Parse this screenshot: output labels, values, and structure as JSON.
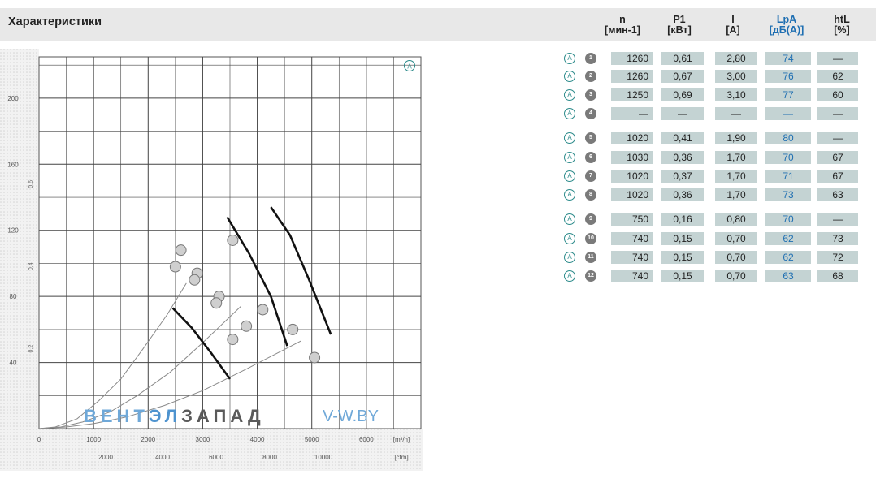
{
  "header": {
    "title": "Характеристики"
  },
  "table": {
    "columns": [
      {
        "label": "n",
        "unit": "[мин-1]",
        "color": "#222222"
      },
      {
        "label": "P1",
        "unit": "[кВт]",
        "color": "#222222"
      },
      {
        "label": "I",
        "unit": "[A]",
        "color": "#222222"
      },
      {
        "label": "LpA",
        "unit": "[дБ(A)]",
        "color": "#1f6fb2"
      },
      {
        "label": "htL",
        "unit": "[%]",
        "color": "#222222"
      }
    ],
    "rows": [
      {
        "mark": "A",
        "num": "1",
        "n": "1260",
        "p1": "0,61",
        "i": "2,80",
        "lpa": "74",
        "htl": "—"
      },
      {
        "mark": "A",
        "num": "2",
        "n": "1260",
        "p1": "0,67",
        "i": "3,00",
        "lpa": "76",
        "htl": "62"
      },
      {
        "mark": "A",
        "num": "3",
        "n": "1250",
        "p1": "0,69",
        "i": "3,10",
        "lpa": "77",
        "htl": "60"
      },
      {
        "mark": "A",
        "num": "4",
        "n": "—",
        "p1": "—",
        "i": "—",
        "lpa": "—",
        "htl": "—"
      },
      {
        "mark": "A",
        "num": "5",
        "n": "1020",
        "p1": "0,41",
        "i": "1,90",
        "lpa": "80",
        "htl": "—"
      },
      {
        "mark": "A",
        "num": "6",
        "n": "1030",
        "p1": "0,36",
        "i": "1,70",
        "lpa": "70",
        "htl": "67"
      },
      {
        "mark": "A",
        "num": "7",
        "n": "1020",
        "p1": "0,37",
        "i": "1,70",
        "lpa": "71",
        "htl": "67"
      },
      {
        "mark": "A",
        "num": "8",
        "n": "1020",
        "p1": "0,36",
        "i": "1,70",
        "lpa": "73",
        "htl": "63"
      },
      {
        "mark": "A",
        "num": "9",
        "n": "750",
        "p1": "0,16",
        "i": "0,80",
        "lpa": "70",
        "htl": "—"
      },
      {
        "mark": "A",
        "num": "10",
        "n": "740",
        "p1": "0,15",
        "i": "0,70",
        "lpa": "62",
        "htl": "73"
      },
      {
        "mark": "A",
        "num": "11",
        "n": "740",
        "p1": "0,15",
        "i": "0,70",
        "lpa": "62",
        "htl": "72"
      },
      {
        "mark": "A",
        "num": "12",
        "n": "740",
        "p1": "0,15",
        "i": "0,70",
        "lpa": "63",
        "htl": "68"
      }
    ]
  },
  "chart_data": {
    "type": "line",
    "title": "",
    "curve_label": "A",
    "xlabel_m3h": "[m³/h]",
    "xlabel_cfm": "[cfm]",
    "x_ticks_m3h": [
      "0",
      "1000",
      "2000",
      "3000",
      "4000",
      "5000",
      "6000",
      "[m³/h]"
    ],
    "x_ticks_cfm": [
      "2000",
      "4000",
      "6000",
      "8000",
      "10000",
      "[cfm]"
    ],
    "y_ticks_pa": [
      "40",
      "80",
      "120",
      "160",
      "200"
    ],
    "y_ticks_inwg": [
      "0,2",
      "0,4",
      "0,6"
    ],
    "xlim": [
      0,
      7000
    ],
    "ylim": [
      0,
      225
    ],
    "grid": true,
    "series": [
      {
        "x": [
          2450,
          2800,
          3150,
          3500
        ],
        "y": [
          73,
          61,
          46,
          30
        ]
      },
      {
        "x": [
          3450,
          3850,
          4250,
          4550
        ],
        "y": [
          128,
          106,
          80,
          50
        ]
      },
      {
        "x": [
          4250,
          4600,
          4950,
          5350
        ],
        "y": [
          134,
          117,
          90,
          57
        ]
      }
    ],
    "system_curves": [
      {
        "x": [
          0,
          300,
          700,
          1100,
          1500,
          1900,
          2350,
          2700
        ],
        "y": [
          0,
          1,
          6,
          17,
          30,
          48,
          69,
          88
        ]
      },
      {
        "x": [
          0,
          400,
          800,
          1300,
          1800,
          2400,
          3000,
          3700
        ],
        "y": [
          0,
          1,
          4,
          10,
          20,
          34,
          52,
          74
        ]
      },
      {
        "x": [
          0,
          500,
          1000,
          1600,
          2300,
          3000,
          3800,
          4800
        ],
        "y": [
          0,
          1,
          3,
          7,
          14,
          23,
          36,
          53
        ]
      }
    ],
    "points": [
      {
        "label": "1",
        "x": 3550,
        "y": 114
      },
      {
        "label": "2",
        "x": 4100,
        "y": 72
      },
      {
        "label": "3",
        "x": 4650,
        "y": 60
      },
      {
        "label": "4",
        "x": 5050,
        "y": 43
      },
      {
        "label": "5",
        "x": 2600,
        "y": 108
      },
      {
        "label": "6",
        "x": 2900,
        "y": 94
      },
      {
        "label": "7",
        "x": 3300,
        "y": 80
      },
      {
        "label": "8",
        "x": 3800,
        "y": 62
      },
      {
        "label": "9",
        "x": 2500,
        "y": 98
      },
      {
        "label": "10",
        "x": 2850,
        "y": 90
      },
      {
        "label": "11",
        "x": 3250,
        "y": 76
      },
      {
        "label": "12",
        "x": 3550,
        "y": 54
      }
    ]
  },
  "watermark": {
    "part1": "ВЕНТ",
    "part2": "ЭЛ",
    "part3": "ЗАПАД",
    "part4": "V-W.BY"
  }
}
